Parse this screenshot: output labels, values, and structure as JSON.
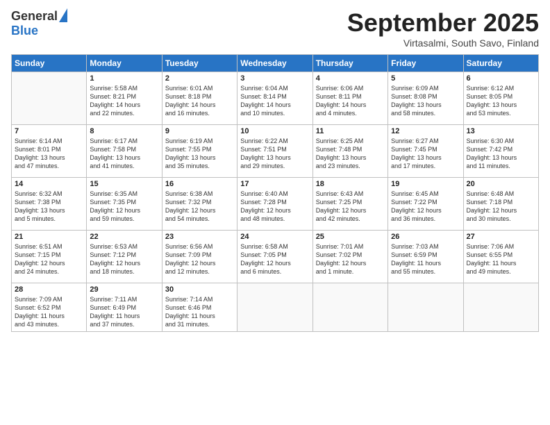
{
  "logo": {
    "general": "General",
    "blue": "Blue"
  },
  "title": "September 2025",
  "location": "Virtasalmi, South Savo, Finland",
  "days_header": [
    "Sunday",
    "Monday",
    "Tuesday",
    "Wednesday",
    "Thursday",
    "Friday",
    "Saturday"
  ],
  "weeks": [
    [
      {
        "day": "",
        "info": ""
      },
      {
        "day": "1",
        "info": "Sunrise: 5:58 AM\nSunset: 8:21 PM\nDaylight: 14 hours\nand 22 minutes."
      },
      {
        "day": "2",
        "info": "Sunrise: 6:01 AM\nSunset: 8:18 PM\nDaylight: 14 hours\nand 16 minutes."
      },
      {
        "day": "3",
        "info": "Sunrise: 6:04 AM\nSunset: 8:14 PM\nDaylight: 14 hours\nand 10 minutes."
      },
      {
        "day": "4",
        "info": "Sunrise: 6:06 AM\nSunset: 8:11 PM\nDaylight: 14 hours\nand 4 minutes."
      },
      {
        "day": "5",
        "info": "Sunrise: 6:09 AM\nSunset: 8:08 PM\nDaylight: 13 hours\nand 58 minutes."
      },
      {
        "day": "6",
        "info": "Sunrise: 6:12 AM\nSunset: 8:05 PM\nDaylight: 13 hours\nand 53 minutes."
      }
    ],
    [
      {
        "day": "7",
        "info": "Sunrise: 6:14 AM\nSunset: 8:01 PM\nDaylight: 13 hours\nand 47 minutes."
      },
      {
        "day": "8",
        "info": "Sunrise: 6:17 AM\nSunset: 7:58 PM\nDaylight: 13 hours\nand 41 minutes."
      },
      {
        "day": "9",
        "info": "Sunrise: 6:19 AM\nSunset: 7:55 PM\nDaylight: 13 hours\nand 35 minutes."
      },
      {
        "day": "10",
        "info": "Sunrise: 6:22 AM\nSunset: 7:51 PM\nDaylight: 13 hours\nand 29 minutes."
      },
      {
        "day": "11",
        "info": "Sunrise: 6:25 AM\nSunset: 7:48 PM\nDaylight: 13 hours\nand 23 minutes."
      },
      {
        "day": "12",
        "info": "Sunrise: 6:27 AM\nSunset: 7:45 PM\nDaylight: 13 hours\nand 17 minutes."
      },
      {
        "day": "13",
        "info": "Sunrise: 6:30 AM\nSunset: 7:42 PM\nDaylight: 13 hours\nand 11 minutes."
      }
    ],
    [
      {
        "day": "14",
        "info": "Sunrise: 6:32 AM\nSunset: 7:38 PM\nDaylight: 13 hours\nand 5 minutes."
      },
      {
        "day": "15",
        "info": "Sunrise: 6:35 AM\nSunset: 7:35 PM\nDaylight: 12 hours\nand 59 minutes."
      },
      {
        "day": "16",
        "info": "Sunrise: 6:38 AM\nSunset: 7:32 PM\nDaylight: 12 hours\nand 54 minutes."
      },
      {
        "day": "17",
        "info": "Sunrise: 6:40 AM\nSunset: 7:28 PM\nDaylight: 12 hours\nand 48 minutes."
      },
      {
        "day": "18",
        "info": "Sunrise: 6:43 AM\nSunset: 7:25 PM\nDaylight: 12 hours\nand 42 minutes."
      },
      {
        "day": "19",
        "info": "Sunrise: 6:45 AM\nSunset: 7:22 PM\nDaylight: 12 hours\nand 36 minutes."
      },
      {
        "day": "20",
        "info": "Sunrise: 6:48 AM\nSunset: 7:18 PM\nDaylight: 12 hours\nand 30 minutes."
      }
    ],
    [
      {
        "day": "21",
        "info": "Sunrise: 6:51 AM\nSunset: 7:15 PM\nDaylight: 12 hours\nand 24 minutes."
      },
      {
        "day": "22",
        "info": "Sunrise: 6:53 AM\nSunset: 7:12 PM\nDaylight: 12 hours\nand 18 minutes."
      },
      {
        "day": "23",
        "info": "Sunrise: 6:56 AM\nSunset: 7:09 PM\nDaylight: 12 hours\nand 12 minutes."
      },
      {
        "day": "24",
        "info": "Sunrise: 6:58 AM\nSunset: 7:05 PM\nDaylight: 12 hours\nand 6 minutes."
      },
      {
        "day": "25",
        "info": "Sunrise: 7:01 AM\nSunset: 7:02 PM\nDaylight: 12 hours\nand 1 minute."
      },
      {
        "day": "26",
        "info": "Sunrise: 7:03 AM\nSunset: 6:59 PM\nDaylight: 11 hours\nand 55 minutes."
      },
      {
        "day": "27",
        "info": "Sunrise: 7:06 AM\nSunset: 6:55 PM\nDaylight: 11 hours\nand 49 minutes."
      }
    ],
    [
      {
        "day": "28",
        "info": "Sunrise: 7:09 AM\nSunset: 6:52 PM\nDaylight: 11 hours\nand 43 minutes."
      },
      {
        "day": "29",
        "info": "Sunrise: 7:11 AM\nSunset: 6:49 PM\nDaylight: 11 hours\nand 37 minutes."
      },
      {
        "day": "30",
        "info": "Sunrise: 7:14 AM\nSunset: 6:46 PM\nDaylight: 11 hours\nand 31 minutes."
      },
      {
        "day": "",
        "info": ""
      },
      {
        "day": "",
        "info": ""
      },
      {
        "day": "",
        "info": ""
      },
      {
        "day": "",
        "info": ""
      }
    ]
  ]
}
